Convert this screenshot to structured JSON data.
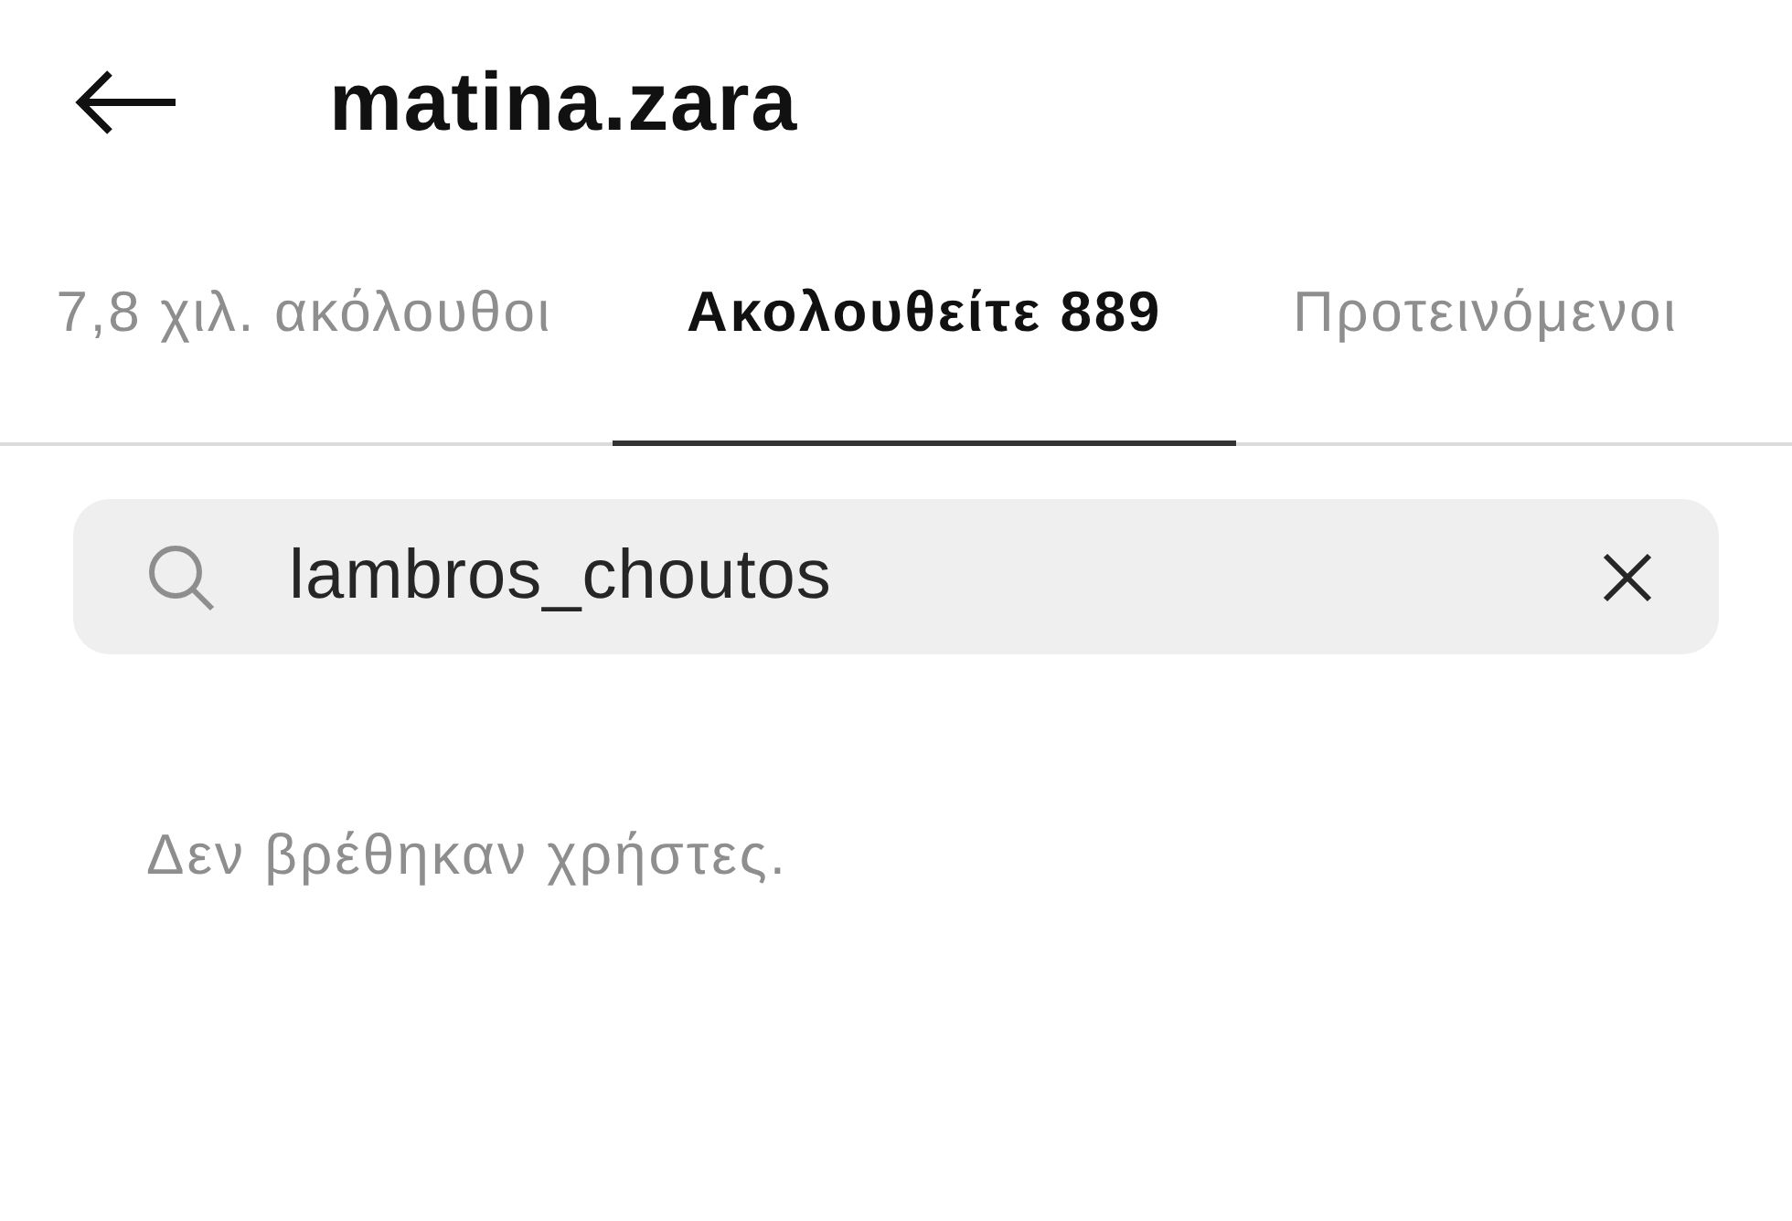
{
  "header": {
    "title": "matina.zara"
  },
  "tabs": [
    {
      "label": "7,8 χιλ. ακόλουθοι",
      "selected": false
    },
    {
      "label": "Ακολουθείτε 889",
      "selected": true
    },
    {
      "label": "Προτεινόμενοι",
      "selected": false
    }
  ],
  "search": {
    "value": "lambros_choutos"
  },
  "empty_message": "Δεν βρέθηκαν χρήστες."
}
